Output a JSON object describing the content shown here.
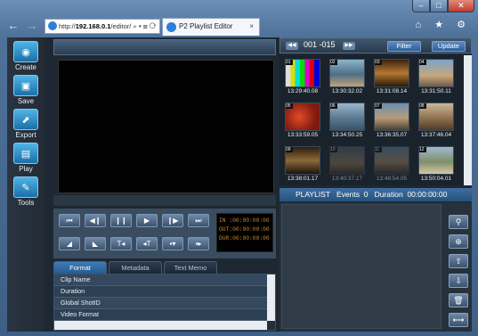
{
  "browser": {
    "url_prefix": "http://",
    "url_host": "192.168.0.1",
    "url_rest": "/editor/",
    "url_tail": " ⌕ ▾ ⊠ ⟳",
    "tab_title": "P2 Playlist Editor",
    "tab_close": "×",
    "right_icons": "⌂ ★ ⚙"
  },
  "sidebar": {
    "items": [
      {
        "label": "Create",
        "icon": "disc-icon"
      },
      {
        "label": "Save",
        "icon": "floppy-icon"
      },
      {
        "label": "Export",
        "icon": "export-icon"
      },
      {
        "label": "Play",
        "icon": "film-icon"
      },
      {
        "label": "Tools",
        "icon": "wrench-icon"
      }
    ]
  },
  "transport": {
    "row1": [
      "⏮",
      "◀❙",
      "❙❙",
      "▶",
      "❙▶",
      "⏭"
    ],
    "row2": [
      "◢",
      "◣",
      "T◂",
      "◂T",
      "▪▾",
      "▪▸"
    ]
  },
  "timecode": {
    "in": "IN :00:00:00:00",
    "out": "OUT:00:00:00:00",
    "dur": "DUR:00:00:00:00"
  },
  "tabs": [
    "Format",
    "Metadata",
    "Text Memo"
  ],
  "meta_rows": [
    "Clip Name",
    "Duration",
    "Global ShotID",
    "Video Format"
  ],
  "clip_panel": {
    "range": "001 -015",
    "filter_label": "Filter",
    "update_label": "Update"
  },
  "clips": [
    {
      "time": "13:29:40.08",
      "dim": false
    },
    {
      "time": "13:30:32.02",
      "dim": false
    },
    {
      "time": "13:31:08.14",
      "dim": false
    },
    {
      "time": "13:31:50.11",
      "dim": false
    },
    {
      "time": "13:33:59.05",
      "dim": false
    },
    {
      "time": "13:34:50.25",
      "dim": false
    },
    {
      "time": "13:36:35.07",
      "dim": false
    },
    {
      "time": "13:37:46.04",
      "dim": false
    },
    {
      "time": "13:38:01.17",
      "dim": false
    },
    {
      "time": "13:40:37.17",
      "dim": true
    },
    {
      "time": "13:48:54.05",
      "dim": true
    },
    {
      "time": "13:50:04.01",
      "dim": false
    }
  ],
  "playlist": {
    "title": "PLAYLIST",
    "events_label": "Events",
    "events_value": "0",
    "duration_label": "Duration",
    "duration_value": "00:00:00:00",
    "buttons": [
      "search-clip-icon",
      "locate-icon",
      "move-up-icon",
      "move-down-icon",
      "trash-icon",
      "fit-icon"
    ]
  }
}
